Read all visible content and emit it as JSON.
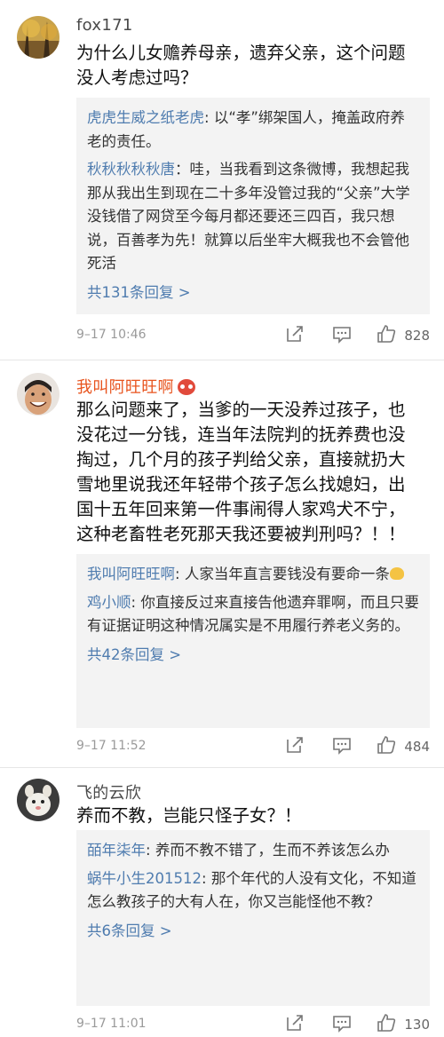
{
  "posts": [
    {
      "user": "fox171",
      "text": "为什么儿女赡养母亲，遗弃父亲，这个问题没人考虑过吗？",
      "replies": [
        {
          "name": "虎虎生威之纸老虎",
          "text": "以“孝”绑架国人，掩盖政府养老的责任。"
        },
        {
          "name": "秋秋秋秋秋唐",
          "text": "哇，当我看到这条微博，我想起我那从我出生到现在二十多年没管过我的“父亲”大学没钱借了网贷至今每月都还要还三四百，我只想说，百善孝为先！就算以后坐牢大概我也不会管他死活"
        }
      ],
      "more": "共131条回复 >",
      "time": "9–17 10:46",
      "likes": "828"
    },
    {
      "user": "我叫阿旺旺啊",
      "text": "那么问题来了，当爹的一天没养过孩子，也没花过一分钱，连当年法院判的抚养费也没掏过，几个月的孩子判给父亲，直接就扔大雪地里说我还年轻带个孩子怎么找媳妇，出国十五年回来第一件事闹得人家鸡犬不宁，这种老畜牲老死那天我还要被判刑吗？！！",
      "replies": [
        {
          "name": "我叫阿旺旺啊",
          "text": "人家当年直言要钱没有要命一条"
        },
        {
          "name": "鸡小顺",
          "text": "你直接反过来直接告他遗弃罪啊，而且只要有证据证明这种情况属实是不用履行养老义务的。"
        }
      ],
      "more": "共42条回复 >",
      "time": "9–17 11:52",
      "likes": "484"
    },
    {
      "user": "飞的云欣",
      "text": "养而不教，岂能只怪子女？！",
      "replies": [
        {
          "name": "皕年柒年",
          "text": "养而不教不错了，生而不养该怎么办"
        },
        {
          "name": "蜗牛小生201512",
          "text": "那个年代的人没有文化，不知道怎么教孩子的大有人在，你又岂能怪他不教？"
        }
      ],
      "more": "共6条回复 >",
      "time": "9–17 11:01",
      "likes": "130"
    }
  ],
  "icons": [
    "share-icon",
    "comment-icon",
    "like-icon"
  ],
  "colors": {
    "link": "#4f7caf",
    "vip_name": "#e8541e",
    "reply_bg": "#f3f3f3"
  }
}
